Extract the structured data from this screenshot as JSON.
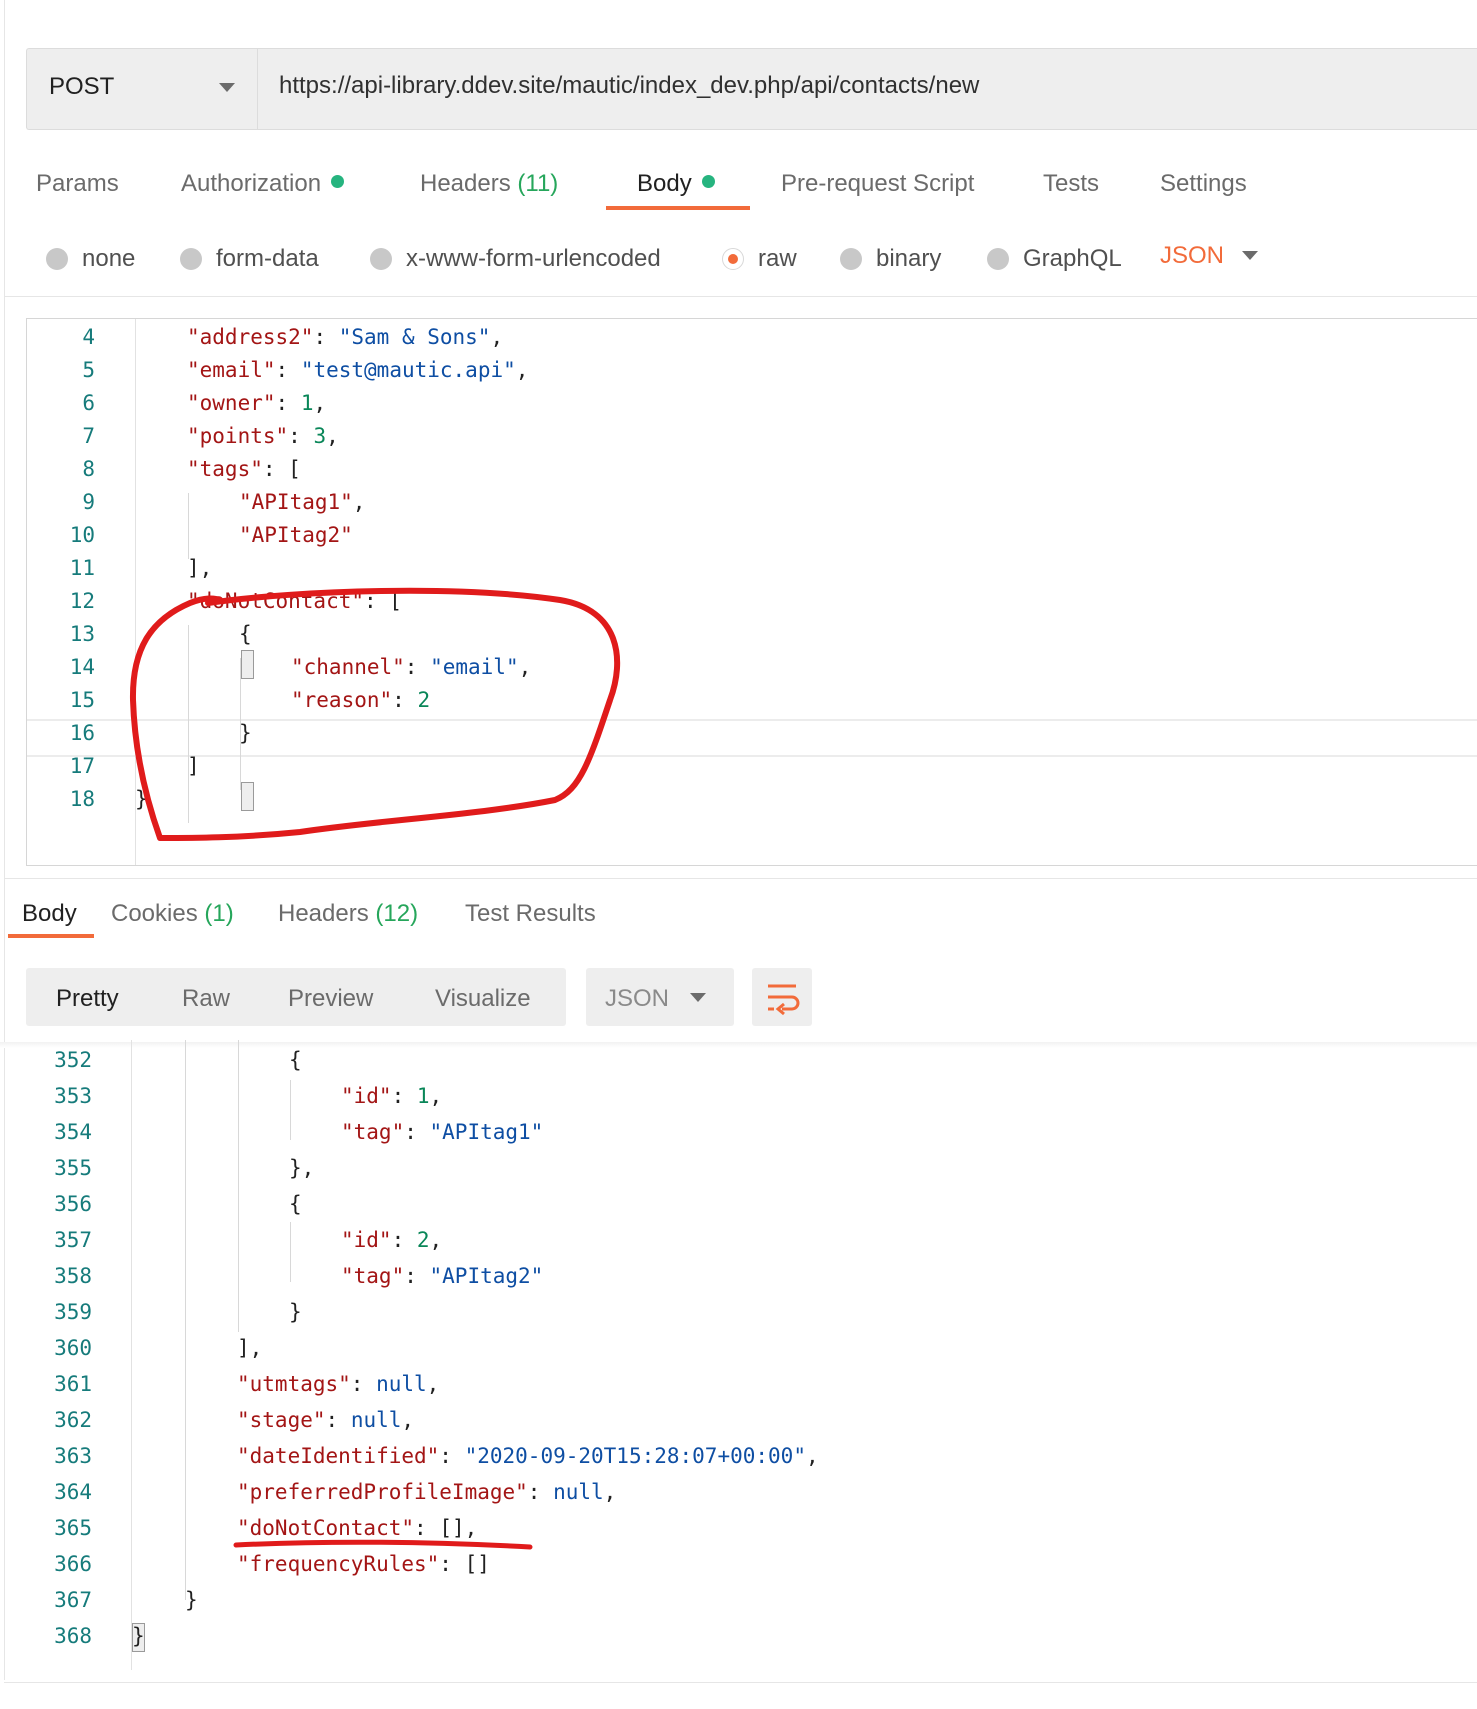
{
  "request": {
    "method": "POST",
    "url": "https://api-library.ddev.site/mautic/index_dev.php/api/contacts/new"
  },
  "request_tabs": {
    "params": "Params",
    "authorization": "Authorization",
    "headers": "Headers",
    "headers_count": "(11)",
    "body": "Body",
    "prerequest": "Pre-request Script",
    "tests": "Tests",
    "settings": "Settings"
  },
  "body_modes": {
    "none": "none",
    "form_data": "form-data",
    "urlencoded": "x-www-form-urlencoded",
    "raw": "raw",
    "binary": "binary",
    "graphql": "GraphQL",
    "selected": "raw",
    "language": "JSON"
  },
  "request_body_lines": [
    {
      "n": "4"
    },
    {
      "n": "5"
    },
    {
      "n": "6"
    },
    {
      "n": "7"
    },
    {
      "n": "8"
    },
    {
      "n": "9"
    },
    {
      "n": "10"
    },
    {
      "n": "11"
    },
    {
      "n": "12"
    },
    {
      "n": "13"
    },
    {
      "n": "14"
    },
    {
      "n": "15"
    },
    {
      "n": "16"
    },
    {
      "n": "17"
    },
    {
      "n": "18"
    }
  ],
  "request_code": {
    "l4_key": "\"address2\"",
    "l4_val": "\"Sam & Sons\"",
    "l5_key": "\"email\"",
    "l5_val": "\"test@mautic.api\"",
    "l6_key": "\"owner\"",
    "l6_val": "1",
    "l7_key": "\"points\"",
    "l7_val": "3",
    "l8_key": "\"tags\"",
    "l9_val": "\"APItag1\"",
    "l10_val": "\"APItag2\"",
    "l12_key": "\"doNotContact\"",
    "l14_key": "\"channel\"",
    "l14_val": "\"email\"",
    "l15_key": "\"reason\"",
    "l15_val": "2"
  },
  "response_tabs": {
    "body": "Body",
    "cookies": "Cookies",
    "cookies_count": "(1)",
    "headers": "Headers",
    "headers_count": "(12)",
    "test_results": "Test Results"
  },
  "response_view": {
    "pretty": "Pretty",
    "raw": "Raw",
    "preview": "Preview",
    "visualize": "Visualize",
    "format": "JSON",
    "wrap_icon": "wrap-lines-icon"
  },
  "response_code": {
    "ln": [
      "352",
      "353",
      "354",
      "355",
      "356",
      "357",
      "358",
      "359",
      "360",
      "361",
      "362",
      "363",
      "364",
      "365",
      "366",
      "367",
      "368"
    ],
    "l353_key": "\"id\"",
    "l353_val": "1",
    "l354_key": "\"tag\"",
    "l354_val": "\"APItag1\"",
    "l357_key": "\"id\"",
    "l357_val": "2",
    "l358_key": "\"tag\"",
    "l358_val": "\"APItag2\"",
    "l361_key": "\"utmtags\"",
    "l361_val": "null",
    "l362_key": "\"stage\"",
    "l362_val": "null",
    "l363_key": "\"dateIdentified\"",
    "l363_val": "\"2020-09-20T15:28:07+00:00\"",
    "l364_key": "\"preferredProfileImage\"",
    "l364_val": "null",
    "l365_key": "\"doNotContact\"",
    "l365_val": "[]",
    "l366_key": "\"frequencyRules\"",
    "l366_val": "[]"
  },
  "colors": {
    "accent": "#f26b3a",
    "success_dot": "#26b47f",
    "json_key": "#a31515",
    "json_string": "#0e4ea3",
    "json_number": "#098658",
    "annotation": "#e01b1b"
  }
}
